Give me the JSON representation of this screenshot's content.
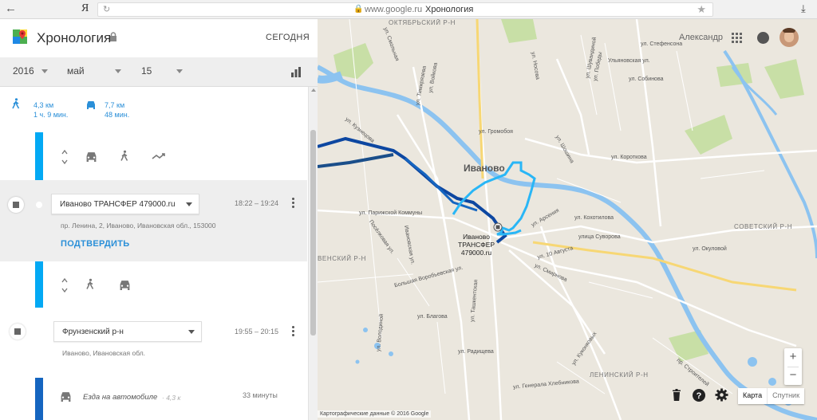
{
  "browser": {
    "back_icon": "back-arrow-icon",
    "yandex_logo": "Я",
    "domain": "www.google.ru",
    "page_title": "Хронология"
  },
  "header": {
    "title": "Хронология",
    "today_button": "СЕГОДНЯ"
  },
  "date_selector": {
    "year": "2016",
    "month": "май",
    "day": "15"
  },
  "summary": {
    "walk": {
      "distance": "4,3 км",
      "duration": "1 ч. 9 мин."
    },
    "drive": {
      "distance": "7,7 км",
      "duration": "48 мин."
    }
  },
  "visits": [
    {
      "place": "Иваново ТРАНСФЕР 479000.ru",
      "time": "18:22 – 19:24",
      "address": "пр. Ленина, 2, Иваново, Ивановская обл., 153000",
      "confirm": "ПОДТВЕРДИТЬ"
    },
    {
      "place": "Фрунзенский р-н",
      "time": "19:55 – 20:15",
      "address": "Иваново, Ивановская обл."
    }
  ],
  "drive_segment": {
    "label": "Езда на автомобиле",
    "distance": "· 4,3 к",
    "duration": "33 минуты"
  },
  "map": {
    "user_name": "Александр",
    "city_label": "Иваново",
    "poi_label": "Иваново\nТРАНСФЕР\n479000.ru",
    "districts": [
      "ОКТЯБРЬСКИЙ Р-Н",
      "СОВЕТСКИЙ Р-Н",
      "ВЕНСКИЙ Р-Н",
      "ЛЕНИНСКИЙ Р-Н"
    ],
    "streets": [
      "ул. Смольная",
      "ул. Тимирязева",
      "ул. Войкова",
      "ул. Носова",
      "ул. Громобоя",
      "ул. Кузнецова",
      "ул. Шошина",
      "ул. Короткова",
      "ул. Парижской Коммуны",
      "ул. Арсения",
      "ул. Кохотилова",
      "улица Суворова",
      "ул. Окуловой",
      "ул. 10 Августа",
      "ул. Смирнова",
      "ул. Благова",
      "ул. Радищева",
      "ул. Генерала Хлебникова",
      "ул. Куконковых",
      "пр. Строителей",
      "Посёлковая ул.",
      "Ивановская ул.",
      "Большая Воробьевская ул.",
      "ул. Володиной",
      "ул. Ташкентская",
      "ул. Стефенсона",
      "ул. Собинова",
      "Ульяновская ул.",
      "ул. Шувандиной",
      "ул. Победы"
    ],
    "zoom_in": "+",
    "zoom_out": "−",
    "map_type_map": "Карта",
    "map_type_satellite": "Спутник",
    "copyright": "Картографические данные © 2016 Google",
    "route_colors": {
      "walk": "#29b6f6",
      "drive": "#0d47a1",
      "dark_drive": "#1a4e8a"
    }
  }
}
